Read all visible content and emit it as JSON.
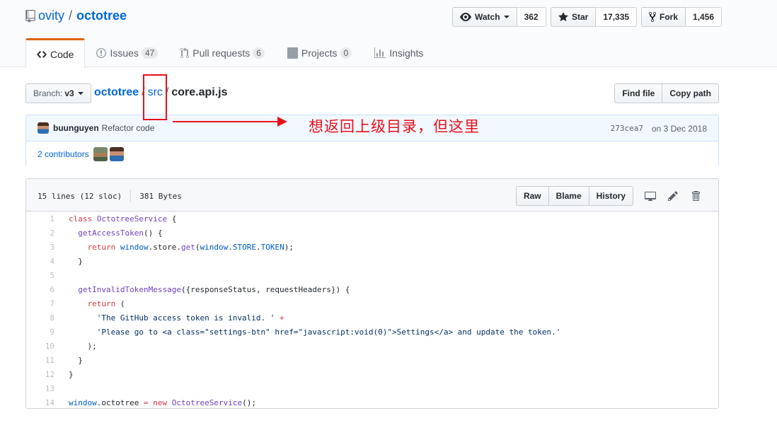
{
  "repo": {
    "owner": "ovity",
    "name": "octotree",
    "separator": "/"
  },
  "actions": {
    "watch_label": "Watch",
    "watch_count": "362",
    "star_label": "Star",
    "star_count": "17,335",
    "fork_label": "Fork",
    "fork_count": "1,456"
  },
  "tabs": [
    {
      "label": "Code",
      "icon": "code-icon",
      "selected": true
    },
    {
      "label": "Issues",
      "icon": "issue-icon",
      "count": "47"
    },
    {
      "label": "Pull requests",
      "icon": "pull-request-icon",
      "count": "6"
    },
    {
      "label": "Projects",
      "icon": "project-icon",
      "count": "0"
    },
    {
      "label": "Insights",
      "icon": "graph-icon"
    }
  ],
  "filenav": {
    "branch_label": "Branch:",
    "branch_value": "v3",
    "crumbs": {
      "repo": "octotree",
      "dir": "src",
      "file": "core.api.js",
      "sep": "/"
    },
    "find_file": "Find file",
    "copy_path": "Copy path"
  },
  "commit": {
    "author": "buunguyen",
    "message": "Refactor code",
    "sha": "273cea7",
    "date": "on 3 Dec 2018",
    "contributors": "2 contributors"
  },
  "file": {
    "lines_info": "15 lines (12 sloc)",
    "size": "381 Bytes",
    "raw": "Raw",
    "blame": "Blame",
    "history": "History"
  },
  "code": [
    {
      "n": "1",
      "text": "class OctotreeService {"
    },
    {
      "n": "2",
      "text": "  getAccessToken() {"
    },
    {
      "n": "3",
      "text": "    return window.store.get(window.STORE.TOKEN);"
    },
    {
      "n": "4",
      "text": "  }"
    },
    {
      "n": "5",
      "text": ""
    },
    {
      "n": "6",
      "text": "  getInvalidTokenMessage({responseStatus, requestHeaders}) {"
    },
    {
      "n": "7",
      "text": "    return ("
    },
    {
      "n": "8",
      "text": "      'The GitHub access token is invalid. ' +"
    },
    {
      "n": "9",
      "text": "      'Please go to <a class=\"settings-btn\" href=\"javascript:void(0)\">Settings</a> and update the token.'"
    },
    {
      "n": "10",
      "text": "    );"
    },
    {
      "n": "11",
      "text": "  }"
    },
    {
      "n": "12",
      "text": "}"
    },
    {
      "n": "13",
      "text": ""
    },
    {
      "n": "14",
      "text": "window.octotree = new OctotreeService();"
    }
  ],
  "annotation": {
    "text": "想返回上级目录，但这里",
    "color": "#e8101c"
  },
  "colors": {
    "link": "#0366d6",
    "tab_accent": "#e36209",
    "keyword": "#d73a49",
    "entity": "#6f42c1",
    "constant": "#005cc5",
    "string": "#032f62"
  }
}
